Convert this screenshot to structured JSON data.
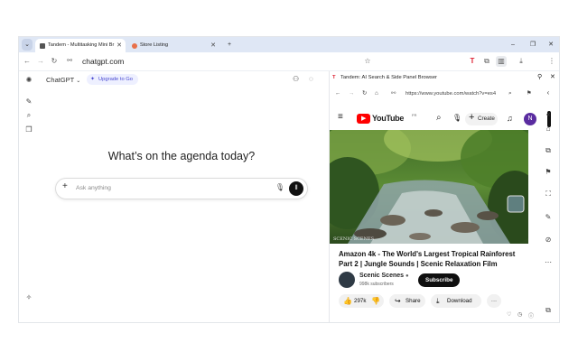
{
  "browser": {
    "tabs": [
      {
        "title": "Tandem - Multitasking Mini Br",
        "active": true
      },
      {
        "title": "Store Listing",
        "active": false
      }
    ],
    "url": "chatgpt.com"
  },
  "chatgpt": {
    "model_label": "ChatGPT",
    "upgrade_label": "Upgrade to Go",
    "heading": "What’s on the agenda today?",
    "input_placeholder": "Ask anything"
  },
  "side_panel": {
    "title": "Tandem: AI Search & Side Panel Browser",
    "url": "https://www.youtube.com/watch?v=es4",
    "youtube": {
      "logo_text": "YouTube",
      "logo_region": "FR",
      "create_label": "Create",
      "avatar_letter": "N",
      "video_watermark": "SCENIC SCENES",
      "video_title": "Amazon 4k - The World's Largest Tropical Rainforest Part 2 | Jungle Sounds | Scenic Relaxation Film",
      "channel_name": "Scenic Scenes",
      "channel_subs": "998k subscribers",
      "subscribe_label": "Subscribe",
      "likes": "297k",
      "share_label": "Share",
      "download_label": "Download"
    }
  },
  "colors": {
    "tab_strip": "#dfe7f5",
    "upgrade_bg": "#eef0ff",
    "youtube_red": "#ff0000",
    "avatar_purple": "#5a2ca0"
  }
}
